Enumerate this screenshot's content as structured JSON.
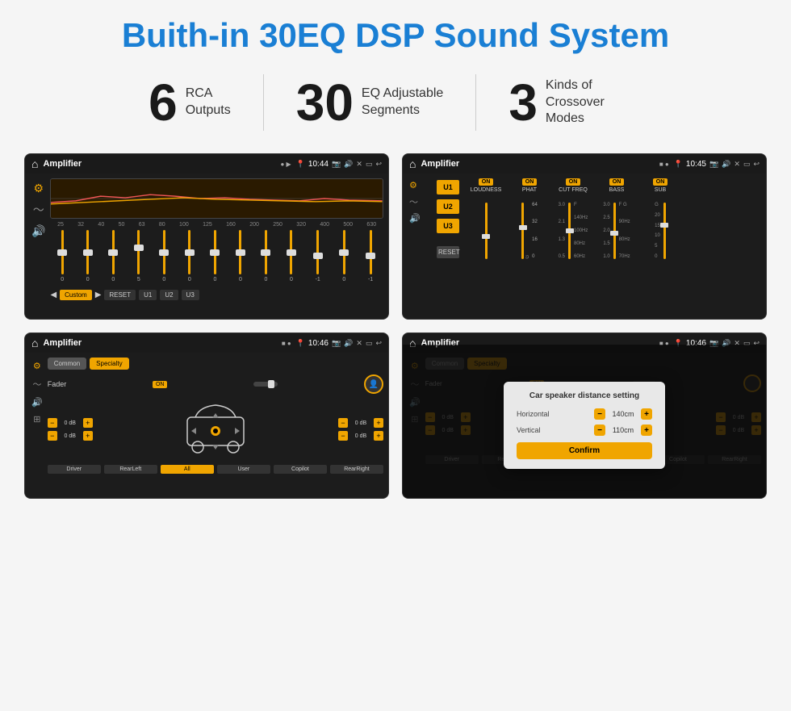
{
  "title": "Buith-in 30EQ DSP Sound System",
  "stats": [
    {
      "number": "6",
      "label": "RCA\nOutputs"
    },
    {
      "number": "30",
      "label": "EQ Adjustable\nSegments"
    },
    {
      "number": "3",
      "label": "Kinds of\nCrossover Modes"
    }
  ],
  "screens": {
    "eq": {
      "app_title": "Amplifier",
      "time": "10:44",
      "freqs": [
        "25",
        "32",
        "40",
        "50",
        "63",
        "80",
        "100",
        "125",
        "160",
        "200",
        "250",
        "320",
        "400",
        "500",
        "630"
      ],
      "slider_values": [
        "0",
        "0",
        "0",
        "5",
        "0",
        "0",
        "0",
        "0",
        "0",
        "0",
        "-1",
        "0",
        "-1"
      ],
      "controls": [
        "Custom",
        "RESET",
        "U1",
        "U2",
        "U3"
      ]
    },
    "crossover": {
      "app_title": "Amplifier",
      "time": "10:45",
      "units": [
        "U1",
        "U2",
        "U3"
      ],
      "cols": [
        {
          "label": "LOUDNESS",
          "on": true
        },
        {
          "label": "PHAT",
          "on": true
        },
        {
          "label": "CUT FREQ",
          "on": true
        },
        {
          "label": "BASS",
          "on": true
        },
        {
          "label": "SUB",
          "on": true
        }
      ]
    },
    "fader": {
      "app_title": "Amplifier",
      "time": "10:46",
      "tabs": [
        "Common",
        "Specialty"
      ],
      "fader_label": "Fader",
      "db_values": [
        "0 dB",
        "0 dB",
        "0 dB",
        "0 dB"
      ],
      "footer_buttons": [
        "Driver",
        "RearLeft",
        "All",
        "User",
        "Copilot",
        "RearRight"
      ]
    },
    "distance": {
      "app_title": "Amplifier",
      "time": "10:46",
      "tabs": [
        "Common",
        "Specialty"
      ],
      "modal": {
        "title": "Car speaker distance setting",
        "horizontal_label": "Horizontal",
        "horizontal_value": "140cm",
        "vertical_label": "Vertical",
        "vertical_value": "110cm",
        "confirm_label": "Confirm"
      },
      "db_values": [
        "0 dB",
        "0 dB"
      ],
      "footer_buttons": [
        "Driver",
        "RearLeft",
        "All",
        "User",
        "Copilot",
        "RearRight"
      ]
    }
  }
}
